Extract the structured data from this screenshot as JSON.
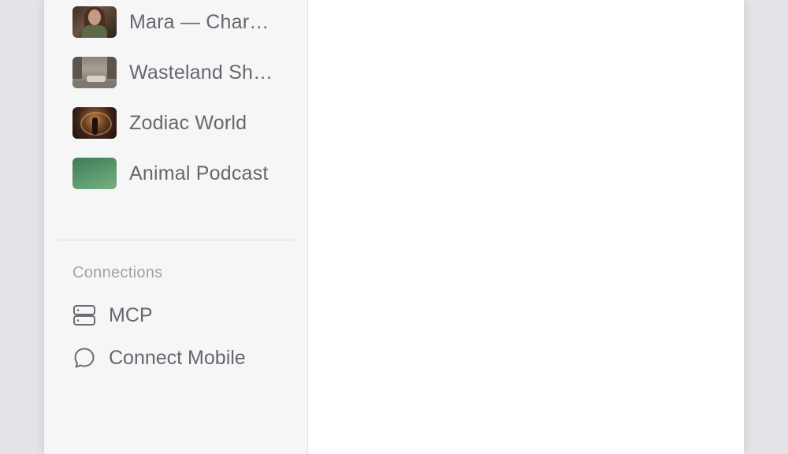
{
  "sidebar": {
    "projects": [
      {
        "label": "Mara — Char…",
        "thumb": "portrait-woman-thumbnail"
      },
      {
        "label": "Wasteland Sh…",
        "thumb": "city-street-thumbnail"
      },
      {
        "label": "Zodiac World",
        "thumb": "zodiac-scene-thumbnail"
      },
      {
        "label": "Animal Podcast",
        "thumb": "green-gradient-thumbnail"
      }
    ],
    "connections": {
      "title": "Connections",
      "items": [
        {
          "label": "MCP",
          "icon": "server-icon"
        },
        {
          "label": "Connect Mobile",
          "icon": "chat-bubble-icon"
        }
      ]
    }
  },
  "colors": {
    "background": "#e3e3e8",
    "sidebar": "#f6f6f7",
    "text": "#66666f",
    "section_title": "#a1a1aa",
    "divider": "#dcdce0"
  }
}
